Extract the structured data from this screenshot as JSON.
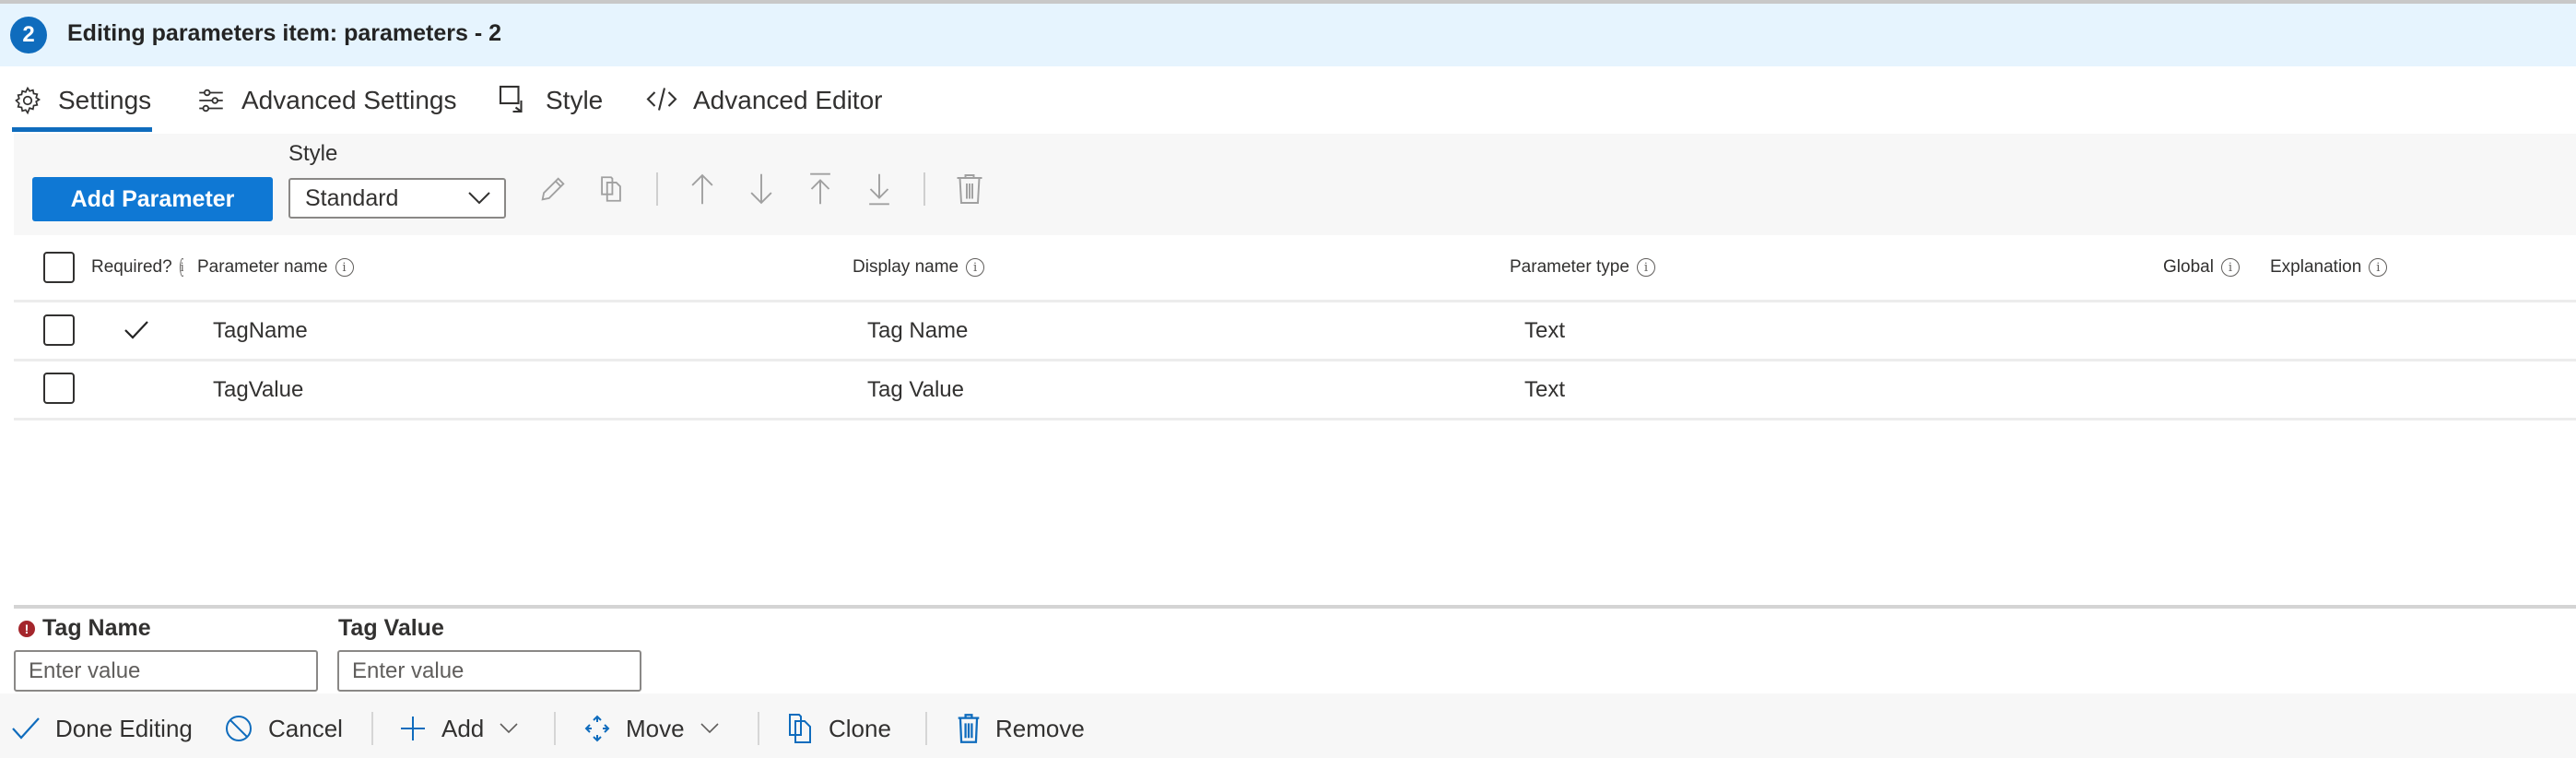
{
  "header": {
    "step_number": "2",
    "title": "Editing parameters item: parameters - 2"
  },
  "tabs": [
    {
      "label": "Settings",
      "icon": "gear-icon",
      "active": true
    },
    {
      "label": "Advanced Settings",
      "icon": "sliders-icon",
      "active": false
    },
    {
      "label": "Style",
      "icon": "style-icon",
      "active": false
    },
    {
      "label": "Advanced Editor",
      "icon": "code-icon",
      "active": false
    }
  ],
  "toolbar": {
    "add_parameter_label": "Add Parameter",
    "style_label": "Style",
    "style_value": "Standard",
    "icons": [
      "edit-icon",
      "copy-icon",
      "move-up-icon",
      "move-down-icon",
      "move-to-top-icon",
      "move-to-bottom-icon",
      "delete-icon"
    ]
  },
  "table": {
    "columns": {
      "required": "Required?",
      "parameter_name": "Parameter name",
      "display_name": "Display name",
      "parameter_type": "Parameter type",
      "global": "Global",
      "explanation": "Explanation"
    },
    "rows": [
      {
        "required": true,
        "parameter_name": "TagName",
        "display_name": "Tag Name",
        "parameter_type": "Text",
        "global": "",
        "explanation": ""
      },
      {
        "required": false,
        "parameter_name": "TagValue",
        "display_name": "Tag Value",
        "parameter_type": "Text",
        "global": "",
        "explanation": ""
      }
    ]
  },
  "preview": {
    "fields": [
      {
        "label": "Tag Name",
        "required_error": true,
        "placeholder": "Enter value",
        "value": ""
      },
      {
        "label": "Tag Value",
        "required_error": false,
        "placeholder": "Enter value",
        "value": ""
      }
    ]
  },
  "footer": {
    "done_label": "Done Editing",
    "cancel_label": "Cancel",
    "add_label": "Add",
    "move_label": "Move",
    "clone_label": "Clone",
    "remove_label": "Remove"
  },
  "colors": {
    "accent": "#0f6cbd",
    "button": "#0f78d4",
    "header_bg": "#e6f4fe",
    "error": "#a4262c"
  }
}
